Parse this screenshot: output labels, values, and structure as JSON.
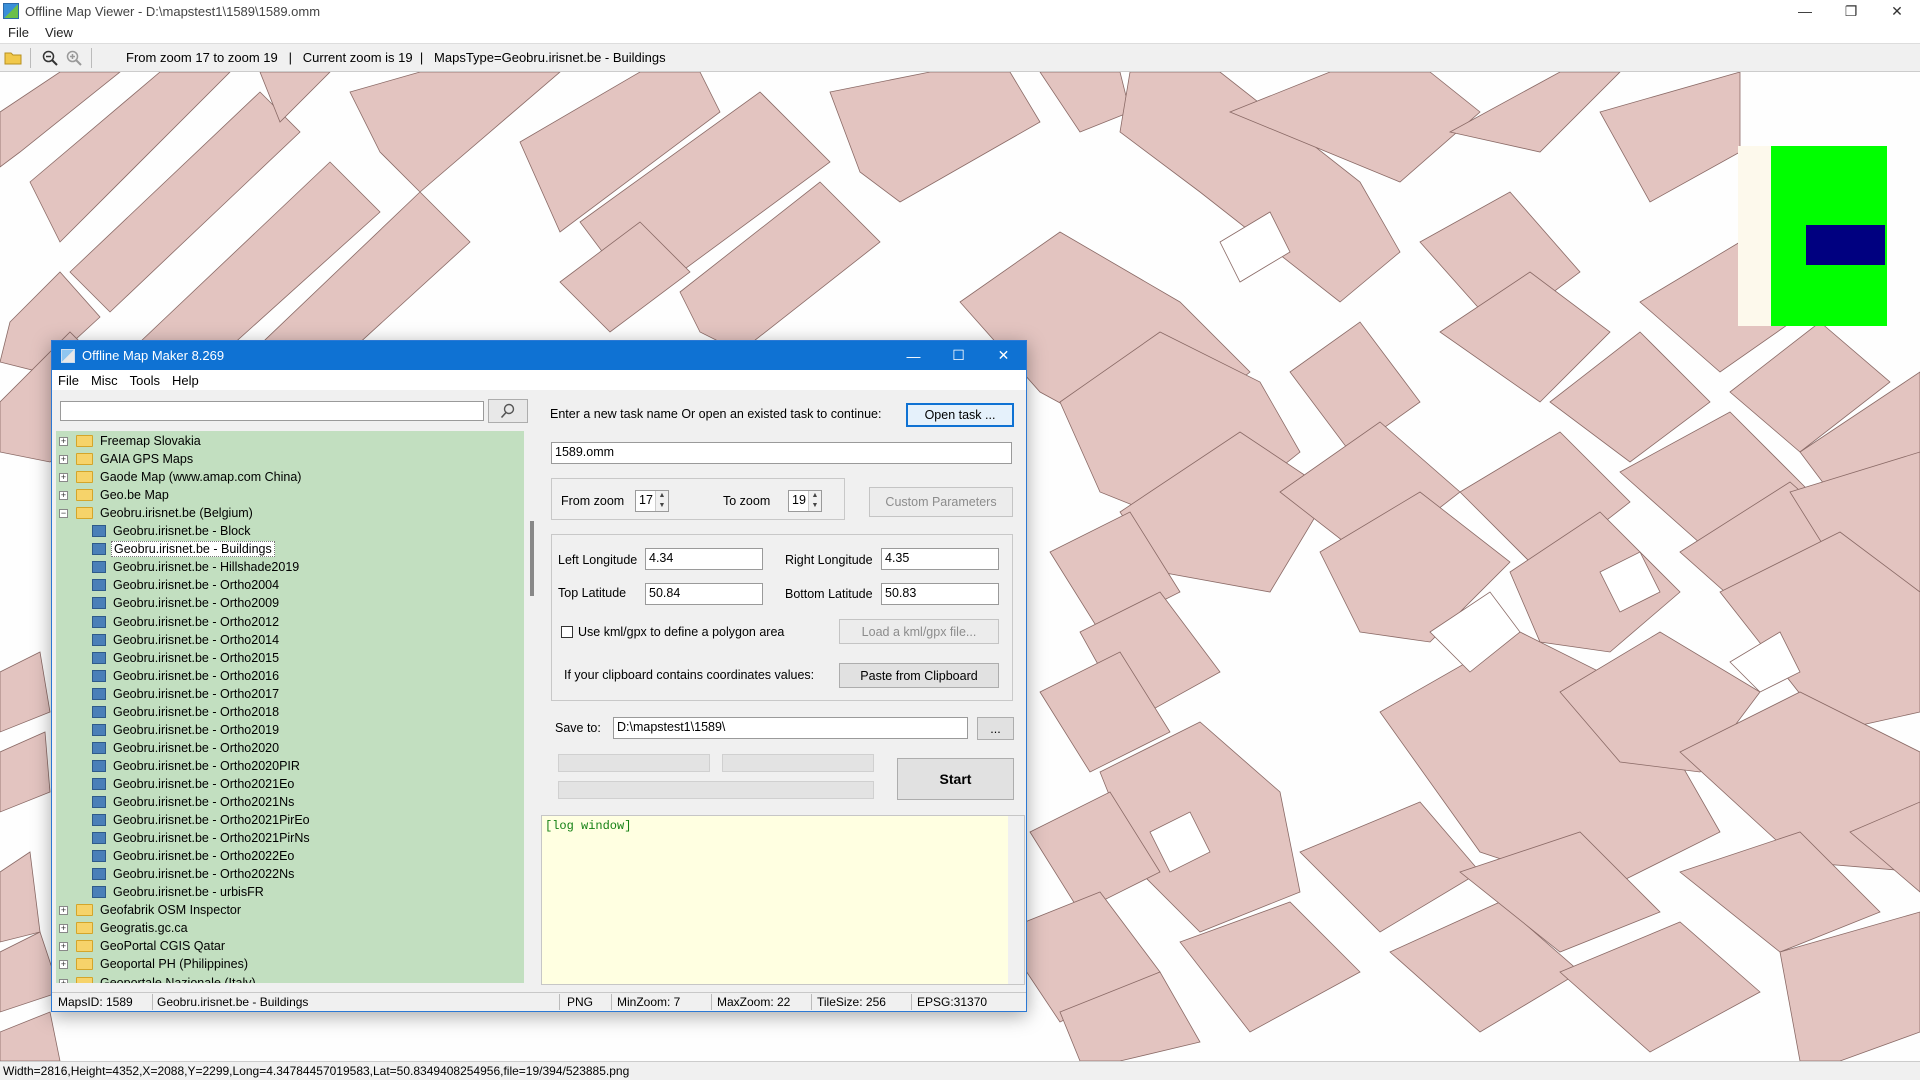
{
  "viewer": {
    "title": "Offline Map Viewer - D:\\mapstest1\\1589\\1589.omm",
    "menu": [
      "File",
      "View"
    ],
    "toolbar_info": "From zoom 17 to zoom 19   |   Current zoom is 19  |   MapsType=Geobru.irisnet.be - Buildings",
    "status": "Width=2816,Height=4352,X=2088,Y=2299,Long=4.34784457019583,Lat=50.8349408254956,file=19/394/523885.png",
    "colors": {
      "building": "#e3c4c0",
      "building_stroke": "#8a6a66",
      "minimap_green": "#00ff00",
      "minimap_blue": "#000080"
    }
  },
  "dialog": {
    "title": "Offline Map Maker 8.269",
    "menu": [
      "File",
      "Misc",
      "Tools",
      "Help"
    ],
    "search": {
      "placeholder": ""
    },
    "tree": [
      {
        "type": "folder",
        "label": "Freemap Slovakia",
        "expanded": false
      },
      {
        "type": "folder",
        "label": "GAIA GPS Maps",
        "expanded": false
      },
      {
        "type": "folder",
        "label": "Gaode Map (www.amap.com China)",
        "expanded": false
      },
      {
        "type": "folder",
        "label": "Geo.be Map",
        "expanded": false
      },
      {
        "type": "folder",
        "label": "Geobru.irisnet.be (Belgium)",
        "expanded": true
      },
      {
        "type": "map",
        "label": "Geobru.irisnet.be - Block"
      },
      {
        "type": "map",
        "label": "Geobru.irisnet.be - Buildings",
        "selected": true
      },
      {
        "type": "map",
        "label": "Geobru.irisnet.be - Hillshade2019"
      },
      {
        "type": "map",
        "label": "Geobru.irisnet.be - Ortho2004"
      },
      {
        "type": "map",
        "label": "Geobru.irisnet.be - Ortho2009"
      },
      {
        "type": "map",
        "label": "Geobru.irisnet.be - Ortho2012"
      },
      {
        "type": "map",
        "label": "Geobru.irisnet.be - Ortho2014"
      },
      {
        "type": "map",
        "label": "Geobru.irisnet.be - Ortho2015"
      },
      {
        "type": "map",
        "label": "Geobru.irisnet.be - Ortho2016"
      },
      {
        "type": "map",
        "label": "Geobru.irisnet.be - Ortho2017"
      },
      {
        "type": "map",
        "label": "Geobru.irisnet.be - Ortho2018"
      },
      {
        "type": "map",
        "label": "Geobru.irisnet.be - Ortho2019"
      },
      {
        "type": "map",
        "label": "Geobru.irisnet.be - Ortho2020"
      },
      {
        "type": "map",
        "label": "Geobru.irisnet.be - Ortho2020PIR"
      },
      {
        "type": "map",
        "label": "Geobru.irisnet.be - Ortho2021Eo"
      },
      {
        "type": "map",
        "label": "Geobru.irisnet.be - Ortho2021Ns"
      },
      {
        "type": "map",
        "label": "Geobru.irisnet.be - Ortho2021PirEo"
      },
      {
        "type": "map",
        "label": "Geobru.irisnet.be - Ortho2021PirNs"
      },
      {
        "type": "map",
        "label": "Geobru.irisnet.be - Ortho2022Eo"
      },
      {
        "type": "map",
        "label": "Geobru.irisnet.be - Ortho2022Ns"
      },
      {
        "type": "map",
        "label": "Geobru.irisnet.be - urbisFR"
      },
      {
        "type": "folder",
        "label": "Geofabrik OSM Inspector",
        "expanded": false
      },
      {
        "type": "folder",
        "label": "Geogratis.gc.ca",
        "expanded": false
      },
      {
        "type": "folder",
        "label": "GeoPortal CGIS Qatar",
        "expanded": false
      },
      {
        "type": "folder",
        "label": "Geoportal PH (Philippines)",
        "expanded": false
      },
      {
        "type": "folder",
        "label": "Geoportale Nazionale (Italy)",
        "expanded": false
      }
    ],
    "task_prompt": "Enter a new task name Or open an existed task to continue:",
    "open_task_label": "Open task ...",
    "task_name": "1589.omm",
    "from_zoom_label": "From zoom",
    "from_zoom_value": "17",
    "to_zoom_label": "To zoom",
    "to_zoom_value": "19",
    "custom_params_label": "Custom Parameters",
    "left_lon_label": "Left Longitude",
    "left_lon_value": "4.34",
    "right_lon_label": "Right Longitude",
    "right_lon_value": "4.35",
    "top_lat_label": "Top Latitude",
    "top_lat_value": "50.84",
    "bottom_lat_label": "Bottom Latitude",
    "bottom_lat_value": "50.83",
    "kml_check_label": "Use kml/gpx to define a polygon area",
    "load_kml_label": "Load a kml/gpx file...",
    "clipboard_prompt": "If your clipboard contains coordinates values:",
    "paste_label": "Paste from Clipboard",
    "save_to_label": "Save to:",
    "save_to_value": "D:\\mapstest1\\1589\\",
    "browse_label": "...",
    "start_label": "Start",
    "log_text": "[log window]",
    "status": {
      "maps_id": "MapsID: 1589",
      "map_name": "Geobru.irisnet.be - Buildings",
      "format": "PNG",
      "min_zoom": "MinZoom: 7",
      "max_zoom": "MaxZoom: 22",
      "tile_size": "TileSize: 256",
      "epsg": "EPSG:31370"
    }
  }
}
